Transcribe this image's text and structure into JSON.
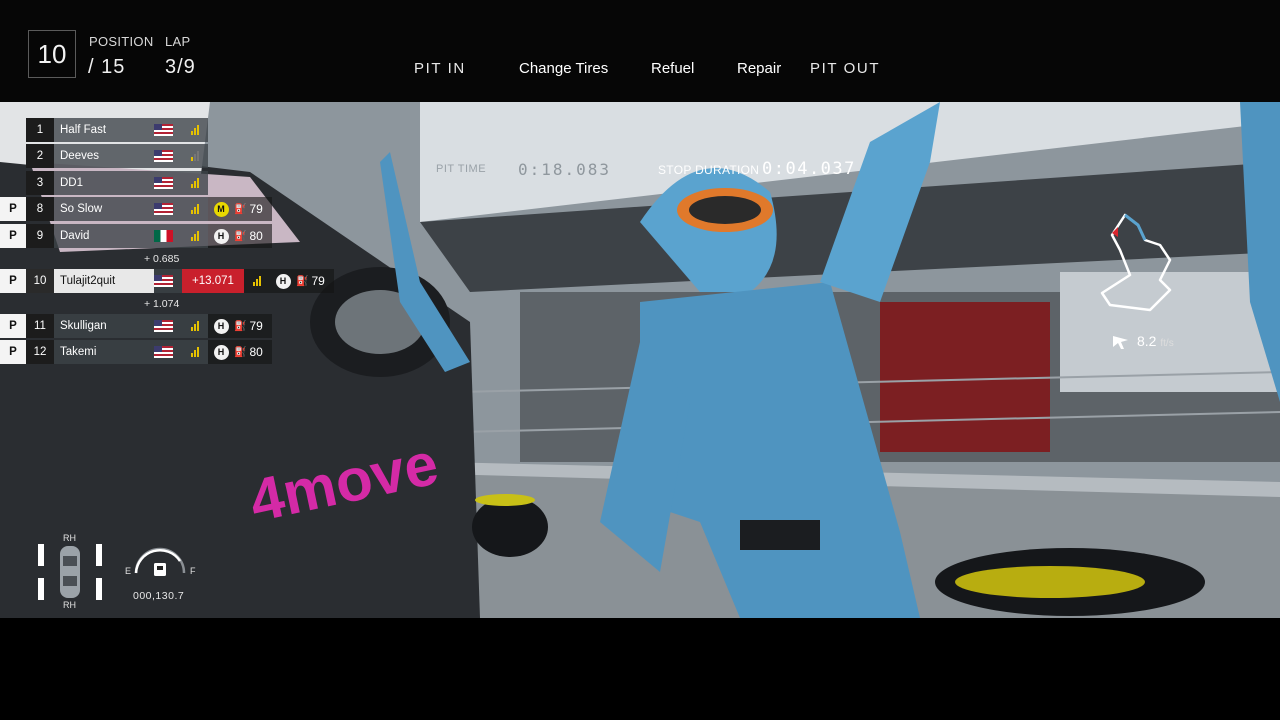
{
  "hud": {
    "position_value": "10",
    "position_label": "POSITION",
    "position_total": "/ 15",
    "lap_label": "LAP",
    "lap_value": "3/9"
  },
  "pit_menu": {
    "pit_in": "PIT IN",
    "change_tires": "Change Tires",
    "refuel": "Refuel",
    "repair": "Repair",
    "pit_out": "PIT OUT"
  },
  "pit_timer": {
    "pit_time_label": "PIT TIME",
    "pit_time_value": "0:18.083",
    "stop_duration_label": "STOP DURATION",
    "stop_duration_value": "0:04.037"
  },
  "leaderboard": [
    {
      "pit": "",
      "pos": "1",
      "name": "Half Fast",
      "flag": "us",
      "tyre": "",
      "fuel": ""
    },
    {
      "pit": "",
      "pos": "2",
      "name": "Deeves",
      "flag": "us",
      "tyre": "",
      "fuel": ""
    },
    {
      "pit": "",
      "pos": "3",
      "name": "DD1",
      "flag": "us",
      "tyre": "",
      "fuel": ""
    },
    {
      "pit": "P",
      "pos": "8",
      "name": "So Slow",
      "flag": "us",
      "tyre": "M",
      "fuel": "79"
    },
    {
      "pit": "P",
      "pos": "9",
      "name": "David",
      "flag": "mx",
      "tyre": "H",
      "fuel": "80"
    },
    {
      "pit": "P",
      "pos": "10",
      "name": "Tulajit2quit",
      "flag": "us",
      "tyre": "H",
      "fuel": "79",
      "gap": "+13.071"
    },
    {
      "pit": "P",
      "pos": "11",
      "name": "Skulligan",
      "flag": "us",
      "tyre": "H",
      "fuel": "79"
    },
    {
      "pit": "P",
      "pos": "12",
      "name": "Takemi",
      "flag": "us",
      "tyre": "H",
      "fuel": "80"
    }
  ],
  "intervals": {
    "ahead": "+ 0.685",
    "behind": "+ 1.074"
  },
  "minimap": {
    "speed_value": "8.2",
    "speed_unit": "ft/s"
  },
  "car_status": {
    "tyre_front": "RH",
    "tyre_rear": "RH",
    "fuel_empty": "E",
    "fuel_full": "F",
    "odometer": "000,130.7"
  },
  "colors": {
    "accent_red": "#c9202c",
    "medium_tyre": "#e9d800",
    "signal": "#e6c200",
    "crew_blue": "#5aa3cf"
  }
}
